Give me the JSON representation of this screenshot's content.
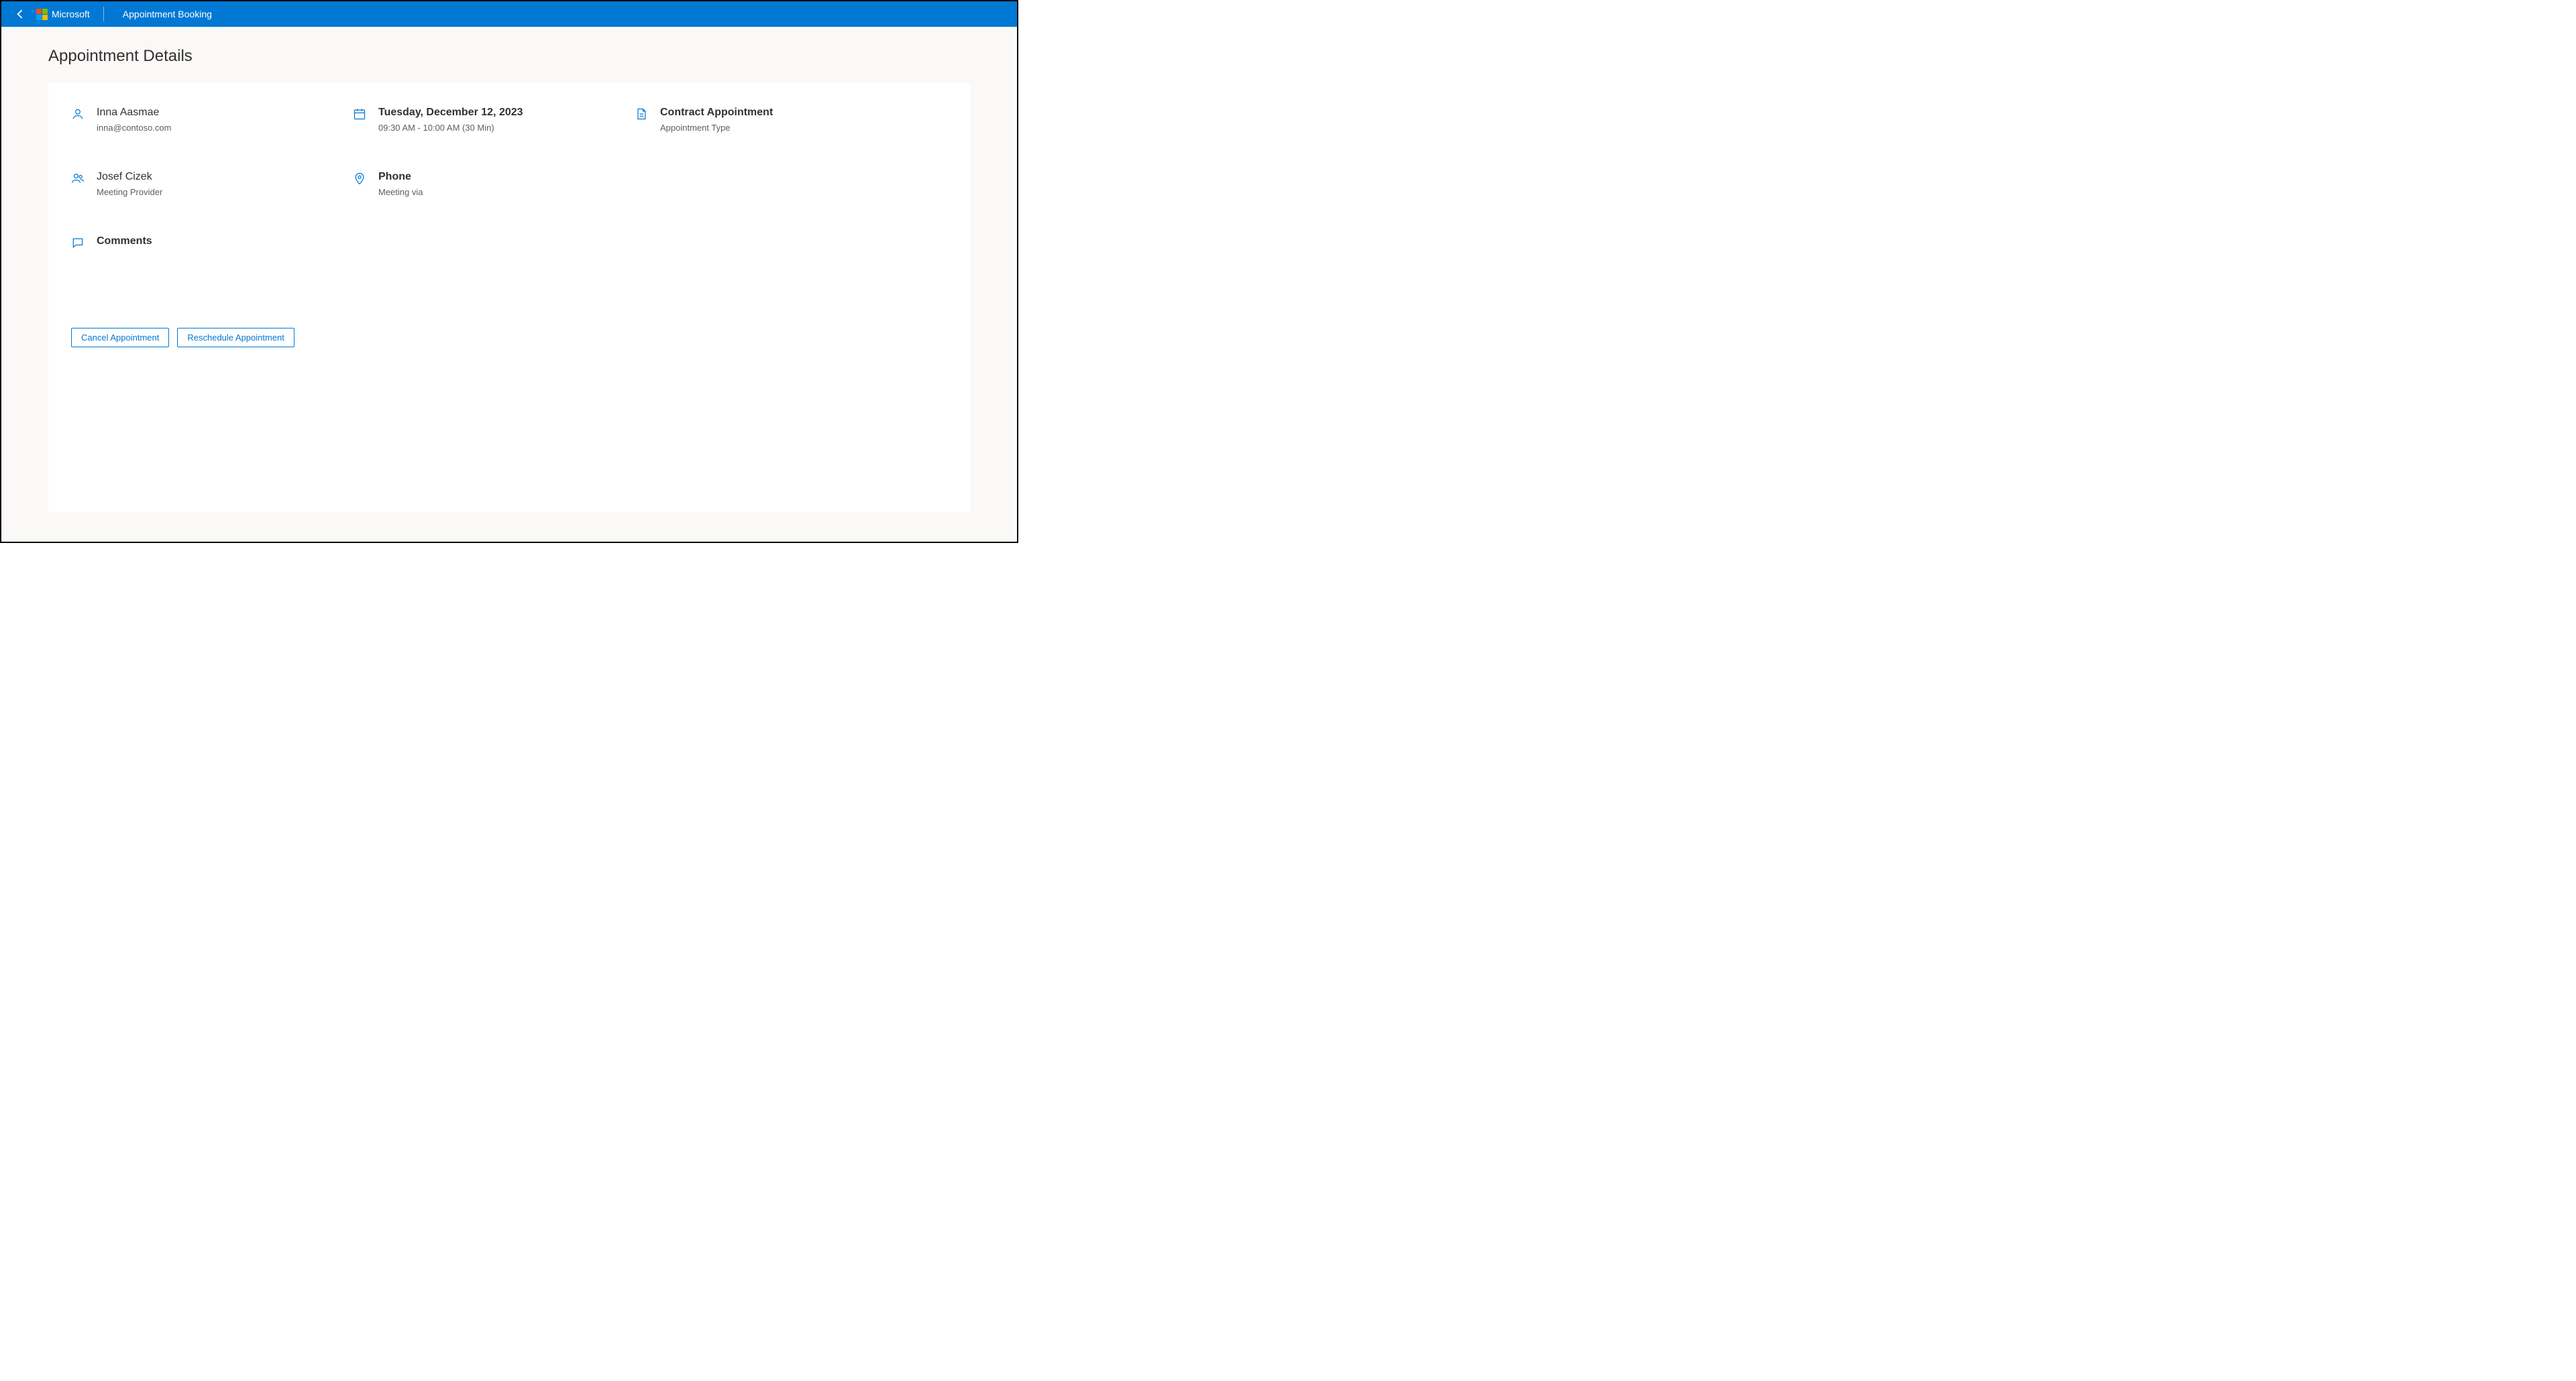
{
  "header": {
    "brand": "Microsoft",
    "title": "Appointment Booking"
  },
  "page": {
    "heading": "Appointment Details"
  },
  "details": {
    "customer": {
      "name": "Inna Aasmae",
      "email": "inna@contoso.com"
    },
    "date": {
      "label": "Tuesday, December 12, 2023",
      "time": "09:30 AM - 10:00 AM (30 Min)"
    },
    "appointmentType": {
      "title": "Contract Appointment",
      "sub": "Appointment Type"
    },
    "provider": {
      "name": "Josef Cizek",
      "role": "Meeting Provider"
    },
    "meetingVia": {
      "title": "Phone",
      "sub": "Meeting via"
    },
    "comments": {
      "label": "Comments",
      "text": ""
    }
  },
  "actions": {
    "cancel": "Cancel Appointment",
    "reschedule": "Reschedule Appointment"
  }
}
